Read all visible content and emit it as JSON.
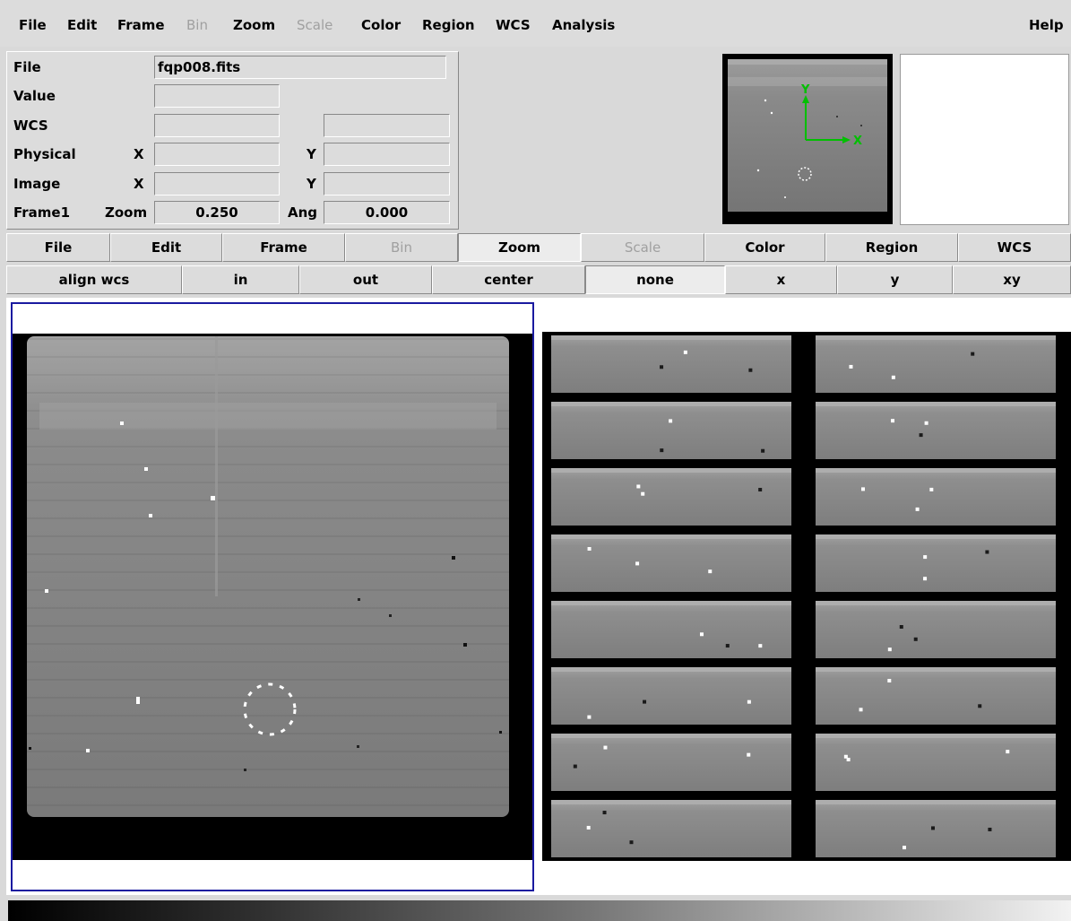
{
  "menubar": {
    "items": [
      {
        "label": "File",
        "enabled": true
      },
      {
        "label": "Edit",
        "enabled": true
      },
      {
        "label": "Frame",
        "enabled": true
      },
      {
        "label": "Bin",
        "enabled": false
      },
      {
        "label": "Zoom",
        "enabled": true
      },
      {
        "label": "Scale",
        "enabled": false
      },
      {
        "label": "Color",
        "enabled": true
      },
      {
        "label": "Region",
        "enabled": true
      },
      {
        "label": "WCS",
        "enabled": true
      },
      {
        "label": "Analysis",
        "enabled": true
      }
    ],
    "help": "Help"
  },
  "info": {
    "file_label": "File",
    "file_value": "fqp008.fits",
    "value_label": "Value",
    "value_value": "",
    "wcs_label": "WCS",
    "wcs_value1": "",
    "wcs_value2": "",
    "physical_label": "Physical",
    "physical_x_label": "X",
    "physical_x": "",
    "physical_y_label": "Y",
    "physical_y": "",
    "image_label": "Image",
    "image_x_label": "X",
    "image_x": "",
    "image_y_label": "Y",
    "image_y": "",
    "frame_label": "Frame1",
    "zoom_label": "Zoom",
    "zoom_value": "0.250",
    "angle_label": "Ang",
    "angle_value": "0.000"
  },
  "panner": {
    "axis_y_label": "Y",
    "axis_x_label": "X",
    "axis_color": "#00c000"
  },
  "buttonbar_main": [
    {
      "label": "File",
      "state": "normal"
    },
    {
      "label": "Edit",
      "state": "normal"
    },
    {
      "label": "Frame",
      "state": "normal"
    },
    {
      "label": "Bin",
      "state": "disabled"
    },
    {
      "label": "Zoom",
      "state": "active"
    },
    {
      "label": "Scale",
      "state": "disabled"
    },
    {
      "label": "Color",
      "state": "normal"
    },
    {
      "label": "Region",
      "state": "normal"
    },
    {
      "label": "WCS",
      "state": "normal"
    }
  ],
  "buttonbar_zoom": [
    {
      "label": "align wcs",
      "state": "normal"
    },
    {
      "label": "in",
      "state": "normal"
    },
    {
      "label": "out",
      "state": "normal"
    },
    {
      "label": "center",
      "state": "normal"
    },
    {
      "label": "none",
      "state": "active"
    },
    {
      "label": "x",
      "state": "normal"
    },
    {
      "label": "y",
      "state": "normal"
    },
    {
      "label": "xy",
      "state": "normal"
    }
  ],
  "display": {
    "current_frame_border_color": "#1a1aa0",
    "region_color": "#ffffff",
    "mosaic_rows": 8,
    "mosaic_cols": 2
  },
  "colorbar": {
    "from": "#000000",
    "to": "#f2f2f2"
  }
}
